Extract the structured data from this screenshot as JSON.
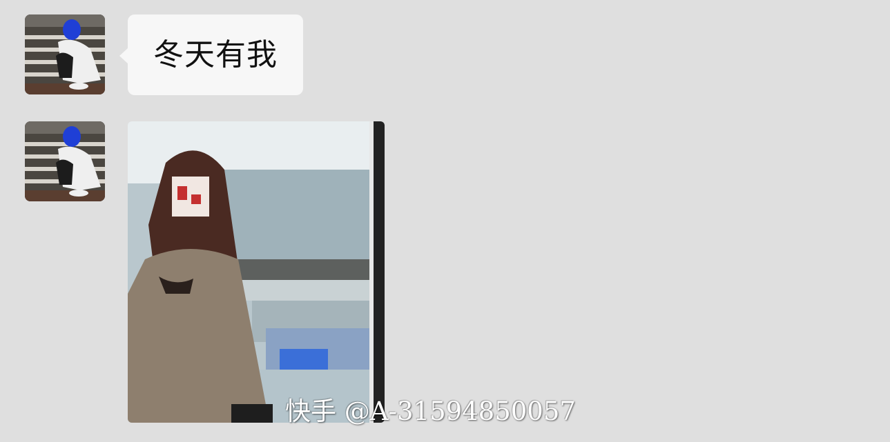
{
  "messages": [
    {
      "type": "text",
      "text": "冬天有我",
      "avatar_icon": "user-avatar-icon"
    },
    {
      "type": "image",
      "avatar_icon": "user-avatar-icon"
    }
  ],
  "watermark": {
    "text": "快手 @A-31594850057"
  },
  "colors": {
    "background": "#dfdfdf",
    "bubble": "#f7f7f7",
    "accent_blue": "#1f3fd6"
  }
}
